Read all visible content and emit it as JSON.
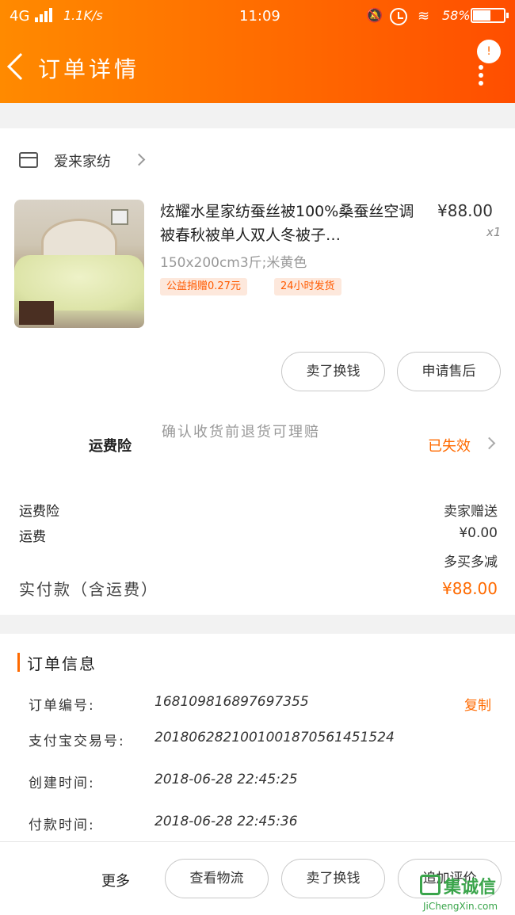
{
  "status_bar": {
    "network": "4G",
    "speed": "1.1K/s",
    "time": "11:09",
    "battery": "58%"
  },
  "header": {
    "title": "订单详情",
    "badge": "!"
  },
  "shop": {
    "name": "爱来家纺"
  },
  "product": {
    "title": "炫耀水星家纺蚕丝被100%桑蚕丝空调被春秋被单人双人冬被子…",
    "price": "¥88.00",
    "qty": "x1",
    "spec": "150x200cm3斤;米黄色",
    "tags": [
      "公益捐赠0.27元",
      "24小时发货"
    ],
    "buttons": [
      "卖了换钱",
      "申请售后"
    ]
  },
  "insurance": {
    "title": "运费险",
    "desc": "确认收货前退货可理赔",
    "status": "已失效"
  },
  "fees": {
    "insurance_label": "运费险",
    "insurance_value": "卖家赠送",
    "shipping_label": "运费",
    "shipping_value": "¥0.00",
    "shipping_note": "多买多减",
    "paid_label": "实付款（含运费）",
    "paid_value": "¥88.00"
  },
  "order_info": {
    "title": "订单信息",
    "copy_label": "复制",
    "rows": [
      {
        "label": "订单编号:",
        "value": "168109816897697355"
      },
      {
        "label": "支付宝交易号:",
        "value": "2018062821001001870561451524"
      },
      {
        "label": "创建时间:",
        "value": "2018-06-28  22:45:25"
      },
      {
        "label": "付款时间:",
        "value": "2018-06-28  22:45:36"
      }
    ]
  },
  "bottom_bar": {
    "more": "更多",
    "buttons": [
      "查看物流",
      "卖了换钱",
      "追加评价"
    ]
  },
  "watermark": {
    "text": "集诚信",
    "url": "JiChengXin.com"
  },
  "colors": {
    "accent": "#ff6a00",
    "header_start": "#ff8a00",
    "header_end": "#ff4e00"
  }
}
